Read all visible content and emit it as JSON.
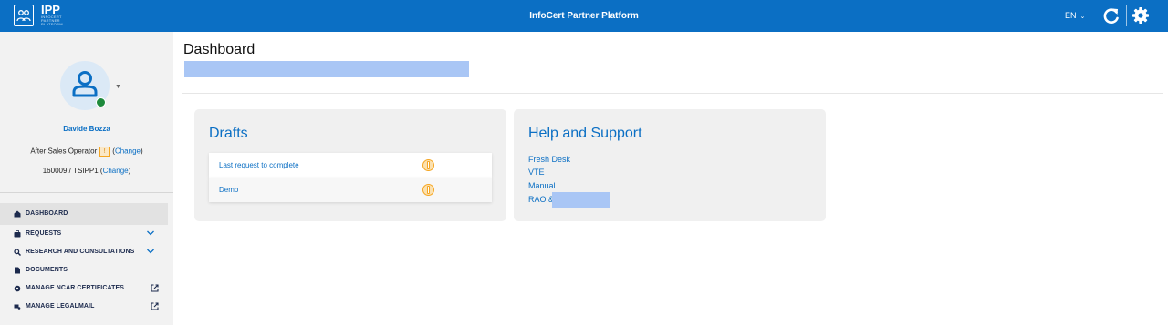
{
  "header": {
    "app_name": "IPP",
    "app_subtitle": "INFOCERT PARTNER PLATFORM",
    "title": "InfoCert Partner Platform",
    "language": "EN"
  },
  "user": {
    "name": "Davide Bozza",
    "role": "After Sales Operator",
    "role_badge": "!",
    "change_label": "Change",
    "org": "160009",
    "org_code": "TSIPP1"
  },
  "nav": {
    "dashboard": "DASHBOARD",
    "requests": "REQUESTS",
    "research": "RESEARCH AND CONSULTATIONS",
    "documents": "DOCUMENTS",
    "ncar": "MANAGE NCAR CERTIFICATES",
    "legalmail": "MANAGE LEGALMAIL"
  },
  "page": {
    "title": "Dashboard"
  },
  "drafts": {
    "title": "Drafts",
    "items": [
      {
        "label": "Last request to complete"
      },
      {
        "label": "Demo"
      }
    ]
  },
  "help": {
    "title": "Help and Support",
    "links": [
      "Fresh Desk",
      "VTE",
      "Manual",
      "RAO &"
    ]
  },
  "colors": {
    "brand": "#0b6fc4",
    "warning": "#f5a623",
    "online": "#1e8a3c"
  }
}
